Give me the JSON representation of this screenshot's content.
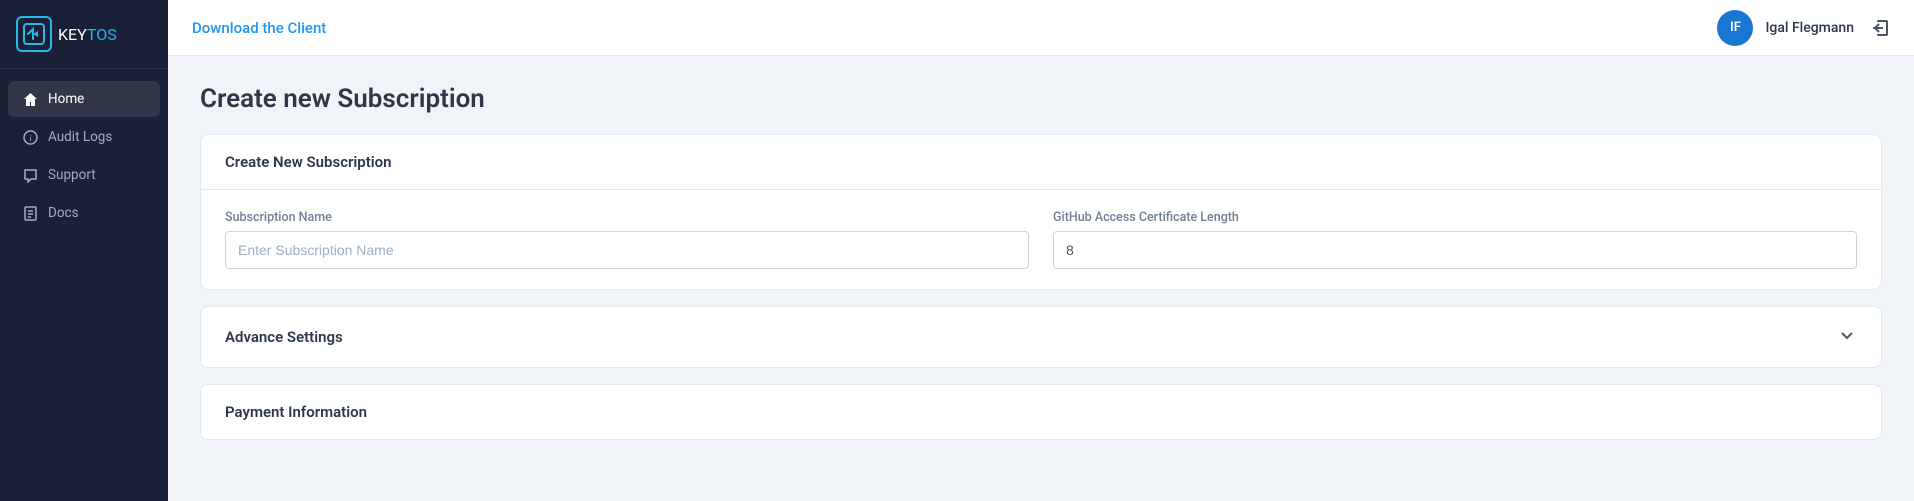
{
  "app": {
    "logo_key": "KEY",
    "logo_tos": "TOS",
    "logo_bracket": "["
  },
  "sidebar": {
    "items": [
      {
        "id": "home",
        "label": "Home",
        "icon": "home",
        "active": true
      },
      {
        "id": "audit-logs",
        "label": "Audit Logs",
        "icon": "list",
        "active": false
      },
      {
        "id": "support",
        "label": "Support",
        "icon": "message",
        "active": false
      },
      {
        "id": "docs",
        "label": "Docs",
        "icon": "file",
        "active": false
      }
    ]
  },
  "header": {
    "download_client_label": "Download the Client",
    "user": {
      "initials": "IF",
      "name": "Igal Flegmann"
    },
    "logout_icon": "→"
  },
  "page": {
    "title": "Create new Subscription",
    "create_subscription_section": {
      "heading": "Create New Subscription",
      "subscription_name_label": "Subscription Name",
      "subscription_name_placeholder": "Enter Subscription Name",
      "github_cert_label": "GitHub Access Certificate Length",
      "github_cert_value": "8"
    },
    "advance_settings": {
      "heading": "Advance Settings"
    },
    "payment_information": {
      "heading": "Payment Information"
    }
  },
  "colors": {
    "brand_blue": "#29b6e8",
    "sidebar_bg": "#1a2035",
    "link_blue": "#2196f3",
    "avatar_blue": "#1976d2"
  }
}
